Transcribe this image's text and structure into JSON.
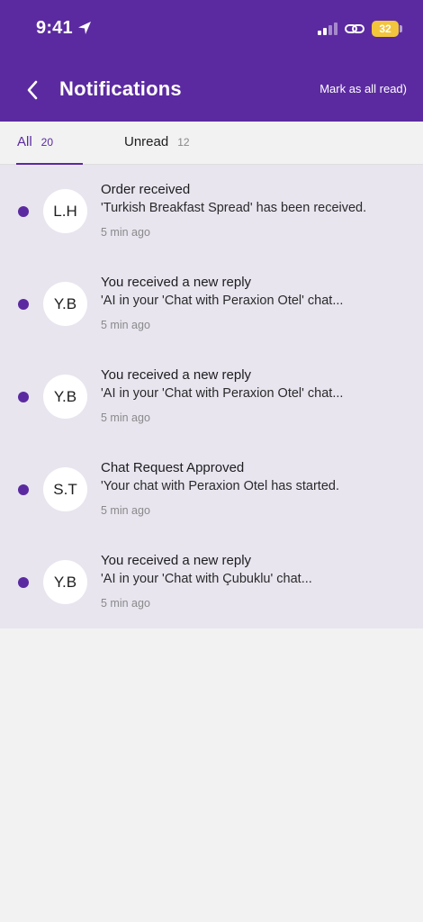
{
  "status_bar": {
    "time": "9:41",
    "battery": "32"
  },
  "header": {
    "title": "Notifications",
    "mark_all_label": "Mark as all read)"
  },
  "tabs": [
    {
      "label": "All",
      "count": "20"
    },
    {
      "label": "Unread",
      "count": "12"
    }
  ],
  "notifications": [
    {
      "initials": "L.H",
      "title": "Order received",
      "body": "'Turkish Breakfast Spread' has been received.",
      "time": "5 min ago"
    },
    {
      "initials": "Y.B",
      "title": "You received a new reply",
      "body": "'AI in your 'Chat with Peraxion Otel' chat...",
      "time": "5 min ago"
    },
    {
      "initials": "Y.B",
      "title": "You received a new reply",
      "body": "'AI in your 'Chat with Peraxion Otel' chat...",
      "time": "5 min ago"
    },
    {
      "initials": "S.T",
      "title": "Chat Request Approved",
      "body": "'Your chat with Peraxion Otel has started.",
      "time": "5 min ago"
    },
    {
      "initials": "Y.B",
      "title": "You received a new reply",
      "body": "'AI in your 'Chat with Çubuklu' chat...",
      "time": "5 min ago"
    }
  ],
  "colors": {
    "brand": "#5b2aa0",
    "unread_background": "#e8e5ef",
    "battery": "#f2c53d"
  }
}
